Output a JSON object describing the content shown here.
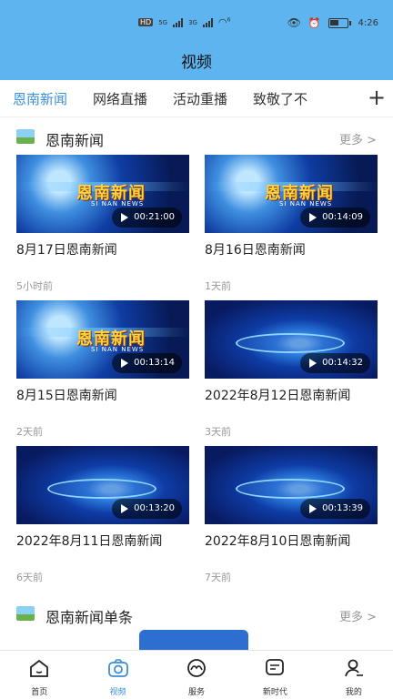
{
  "status_bar": {
    "network": "HD",
    "signal1": "5G",
    "signal2": "3G",
    "wifi": "6",
    "time": "4:26"
  },
  "header": {
    "title": "视频"
  },
  "tabs": [
    {
      "label": "恩南新闻"
    },
    {
      "label": "网络直播"
    },
    {
      "label": "活动重播"
    },
    {
      "label": "致敬了不"
    }
  ],
  "tab_add": "+",
  "section1": {
    "title": "恩南新闻",
    "more": "更多 >"
  },
  "videos": [
    {
      "logo": "恩南新闻",
      "logo_sub": "SI NAN NEWS",
      "duration": "00:21:00",
      "title": "8月17日恩南新闻",
      "time": "5小时前"
    },
    {
      "logo": "恩南新闻",
      "logo_sub": "SI NAN NEWS",
      "duration": "00:14:09",
      "title": "8月16日恩南新闻",
      "time": "1天前"
    },
    {
      "logo": "恩南新闻",
      "logo_sub": "SI NAN NEWS",
      "duration": "00:13:14",
      "title": "8月15日恩南新闻",
      "time": "2天前"
    },
    {
      "duration": "00:14:32",
      "title": "2022年8月12日恩南新闻",
      "time": "3天前"
    },
    {
      "duration": "00:13:20",
      "title": "2022年8月11日恩南新闻",
      "time": "6天前"
    },
    {
      "duration": "00:13:39",
      "title": "2022年8月10日恩南新闻",
      "time": "7天前"
    }
  ],
  "section2": {
    "title": "恩南新闻单条",
    "more": "更多 >"
  },
  "bottom_nav": [
    {
      "label": "首页",
      "icon": "home-icon"
    },
    {
      "label": "视频",
      "icon": "camera-icon"
    },
    {
      "label": "服务",
      "icon": "service-icon"
    },
    {
      "label": "新时代",
      "icon": "chat-icon"
    },
    {
      "label": "我的",
      "icon": "user-icon"
    }
  ],
  "colors": {
    "header": "#5eb4ee",
    "accent": "#3a8fd8"
  }
}
